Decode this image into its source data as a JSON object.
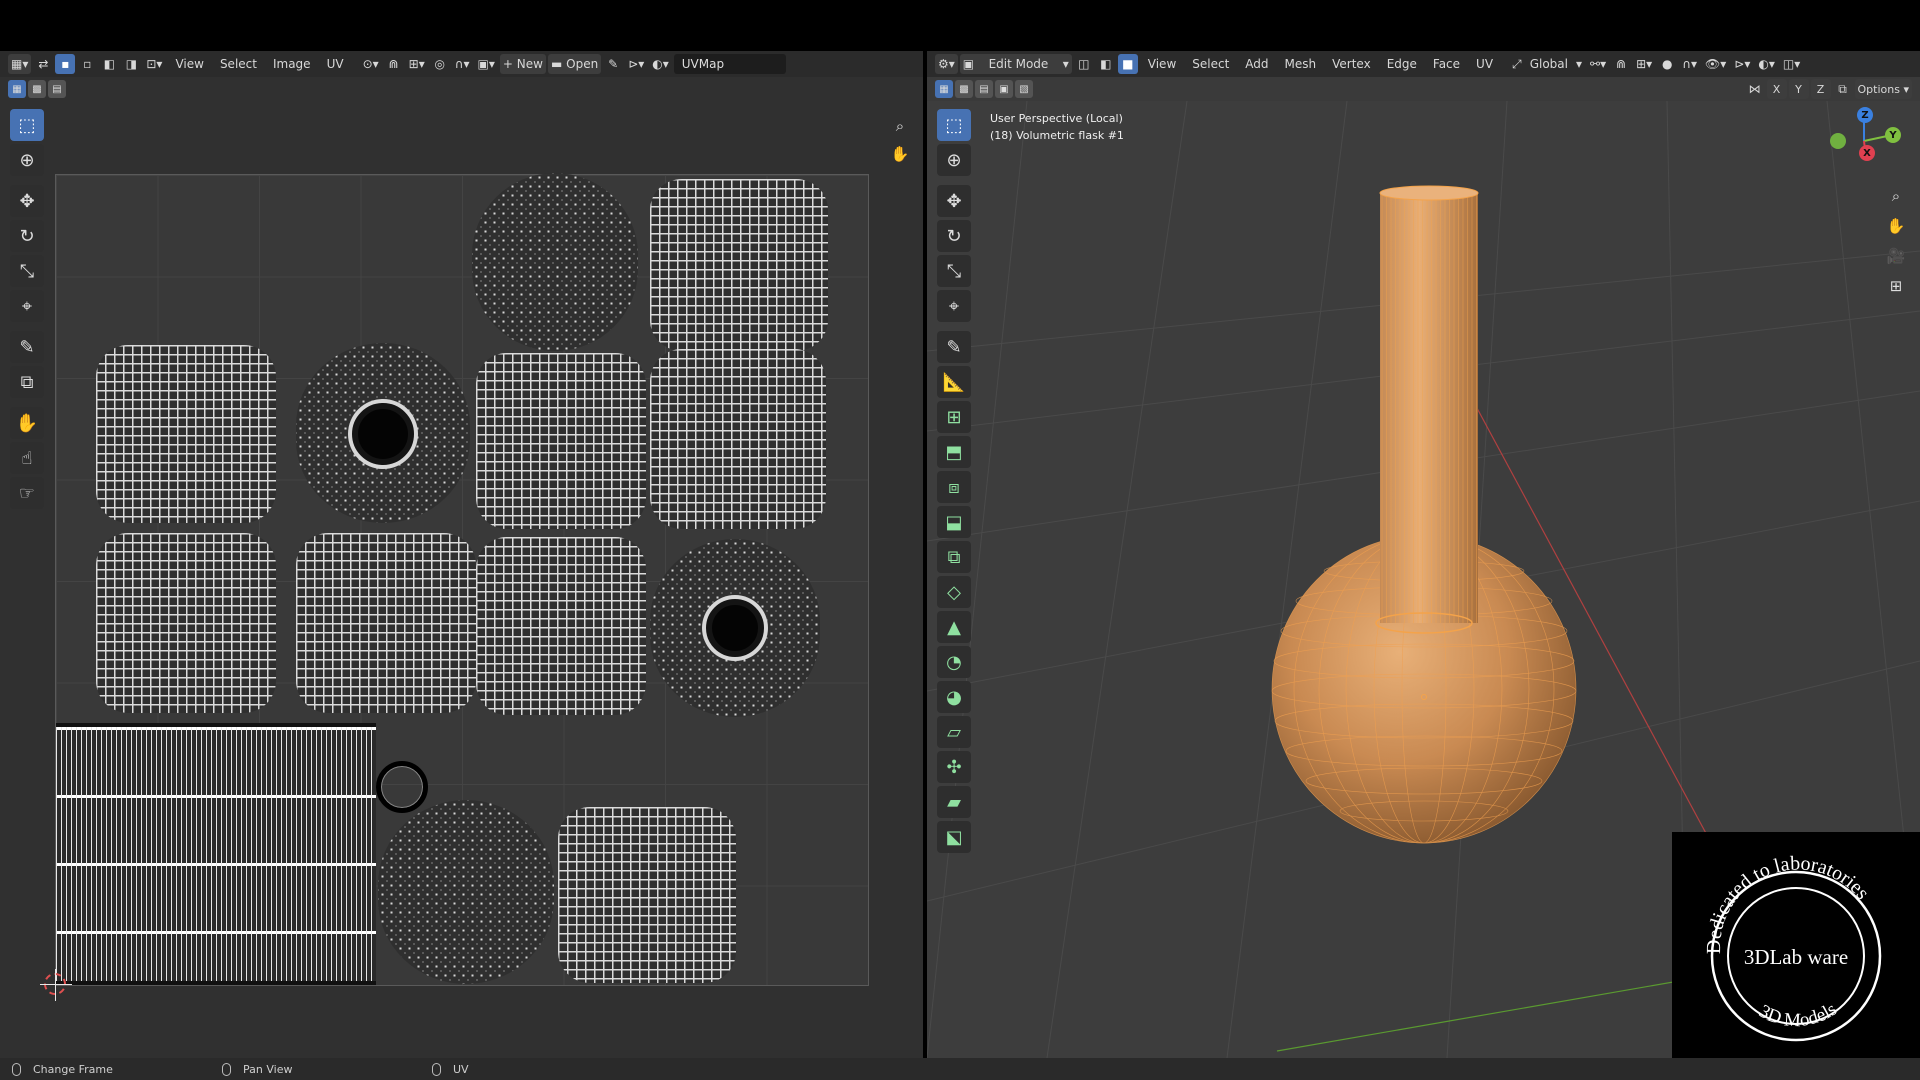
{
  "uv_editor": {
    "menus": [
      "View",
      "Select",
      "Image",
      "UV"
    ],
    "new_label": "New",
    "open_label": "Open",
    "uvmap_name": "UVMap"
  },
  "viewport": {
    "mode_label": "Edit Mode",
    "menus": [
      "View",
      "Select",
      "Add",
      "Mesh",
      "Vertex",
      "Edge",
      "Face",
      "UV"
    ],
    "orientation_label": "Global",
    "axis_x": "X",
    "axis_y": "Y",
    "axis_z": "Z",
    "options_label": "Options",
    "view_name": "User Perspective (Local)",
    "object_name": "(18) Volumetric flask #1",
    "gizmo": {
      "x": "X",
      "y": "Y",
      "z": "Z"
    }
  },
  "watermark": {
    "top_text": "Dedicated to laboratories",
    "center_text": "3DLab ware",
    "bottom_text": "3D Models"
  },
  "statusbar": {
    "items": [
      "Change Frame",
      "Pan View",
      "UV"
    ]
  },
  "colors": {
    "accent": "#4772b3",
    "mesh_orange": "#e8a060",
    "axis_x": "#e04050",
    "axis_y": "#80c040",
    "axis_z": "#3a80e0"
  }
}
